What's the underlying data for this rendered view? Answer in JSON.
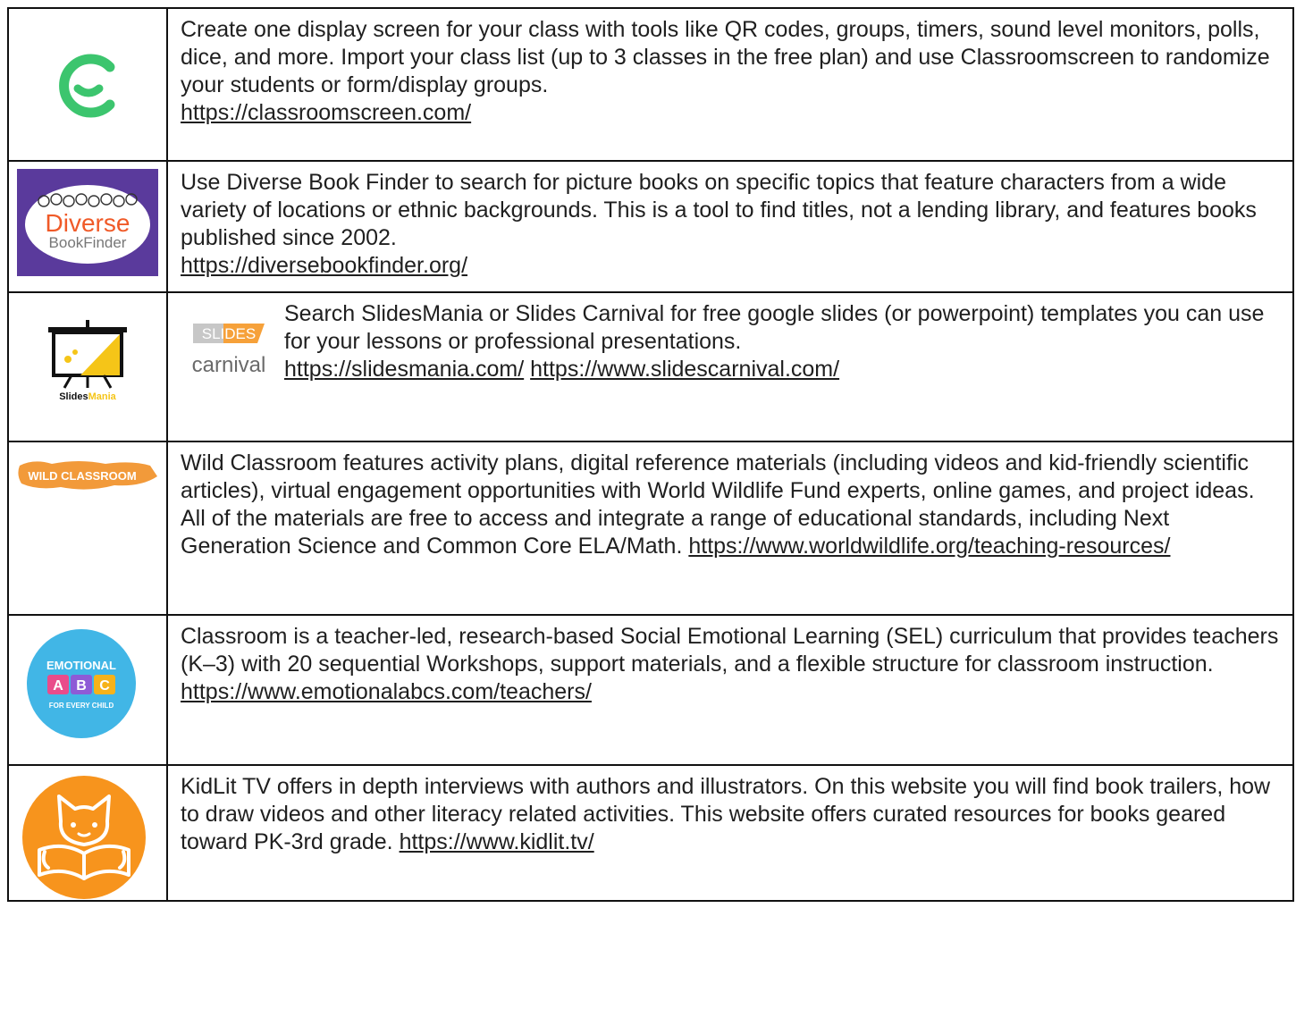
{
  "resources": [
    {
      "logo": "classroomscreen-logo",
      "text": "Create one display screen for your class with tools like QR codes, groups, timers, sound level monitors, polls, dice, and more. Import your class list (up to 3 classes in the free plan) and use Classroomscreen to randomize your students or form/display groups.",
      "link": "https://classroomscreen.com/"
    },
    {
      "logo": "diverse-bookfinder-logo",
      "logo_text_1": "Diverse",
      "logo_text_2": "BookFinder",
      "text": "Use Diverse Book Finder to search for picture books on specific topics that feature characters from a wide variety of locations or ethnic backgrounds.  This is a tool to find titles, not a lending library, and features books published since 2002.",
      "link": "https://diversebookfinder.org/"
    },
    {
      "logo": "slidesmania-logo",
      "logo_text_1": "Slides",
      "logo_text_2": "Mania",
      "inline_logo_text_1": "SLIDES",
      "inline_logo_text_2": "carnival",
      "text": "Search SlidesMania or Slides Carnival for free google slides (or powerpoint) templates you can use for your lessons or professional presentations.",
      "link": "https://slidesmania.com/",
      "link_2": "https://www.slidescarnival.com/"
    },
    {
      "logo": "wild-classroom-logo",
      "logo_text": "WILD CLASSROOM",
      "text": "Wild Classroom features activity plans, digital reference materials (including videos and kid-friendly scientific articles), virtual engagement opportunities with World Wildlife Fund experts, online games, and project ideas. All of the materials are free to access and integrate a range of educational standards, including Next Generation Science and Common Core ELA/Math.",
      "link": "https://www.worldwildlife.org/teaching-resources/"
    },
    {
      "logo": "emotional-abcs-logo",
      "logo_text_1": "EMOTIONAL",
      "logo_letters": [
        "A",
        "B",
        "C"
      ],
      "logo_text_2": "FOR EVERY CHILD",
      "text": "Classroom is a teacher-led, research-based Social Emotional Learning (SEL) curriculum that provides teachers (K–3) with 20 sequential Workshops, support materials, and a flexible structure for classroom instruction.",
      "link": "https://www.emotionalabcs.com/teachers/"
    },
    {
      "logo": "kidlit-tv-logo",
      "text": "KidLit TV offers in depth interviews with authors and illustrators. On this website you will find book trailers, how to draw videos and other literacy related activities.  This website offers curated resources for books geared toward PK-3rd grade.",
      "link": "https://www.kidlit.tv/"
    }
  ],
  "colors": {
    "classroomscreen_green": "#3cc56e",
    "diverse_purple": "#5a3a9c",
    "slides_yellow": "#f5c518",
    "wild_orange": "#f29a3a",
    "emotional_teal": "#41b6e6",
    "kidlit_orange": "#f7941d"
  }
}
